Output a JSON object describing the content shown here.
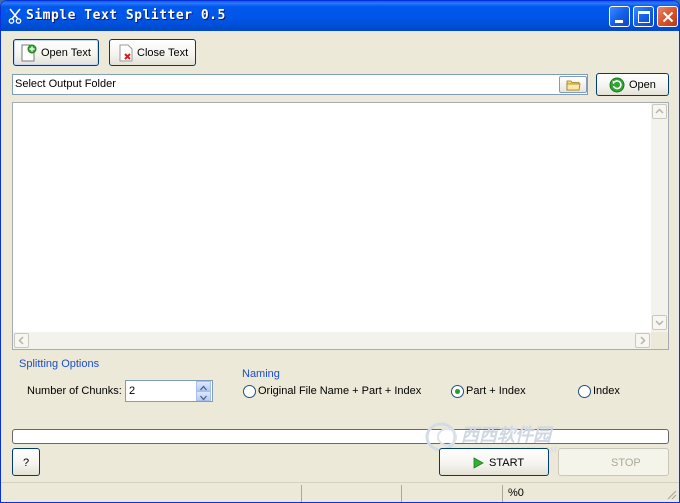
{
  "window": {
    "title": "Simple Text Splitter 0.5",
    "controls": {
      "minimize": "minimize-icon",
      "maximize": "maximize-icon",
      "close": "close-icon"
    }
  },
  "toolbar": {
    "open_text": "Open Text",
    "close_text": "Close Text"
  },
  "output": {
    "folder_value": "Select Output Folder",
    "open_label": "Open"
  },
  "text_area": {
    "content": ""
  },
  "splitting": {
    "title": "Splitting Options",
    "chunks_label": "Number of Chunks:",
    "chunks_value": "2"
  },
  "naming": {
    "title": "Naming",
    "options": [
      {
        "label": "Original File Name + Part + Index",
        "selected": false
      },
      {
        "label": "Part + Index",
        "selected": true
      },
      {
        "label": "Index",
        "selected": false
      }
    ]
  },
  "progress": {
    "value": 0
  },
  "actions": {
    "help_label": "?",
    "start_label": "START",
    "stop_label": "STOP"
  },
  "status": {
    "percent": "%0"
  },
  "watermark": {
    "brand": "西西软件园",
    "url": "CR173.COM"
  },
  "colors": {
    "accent": "#1c4ec7",
    "title_bar": "#0055e5",
    "radio_dot": "#21a121"
  }
}
